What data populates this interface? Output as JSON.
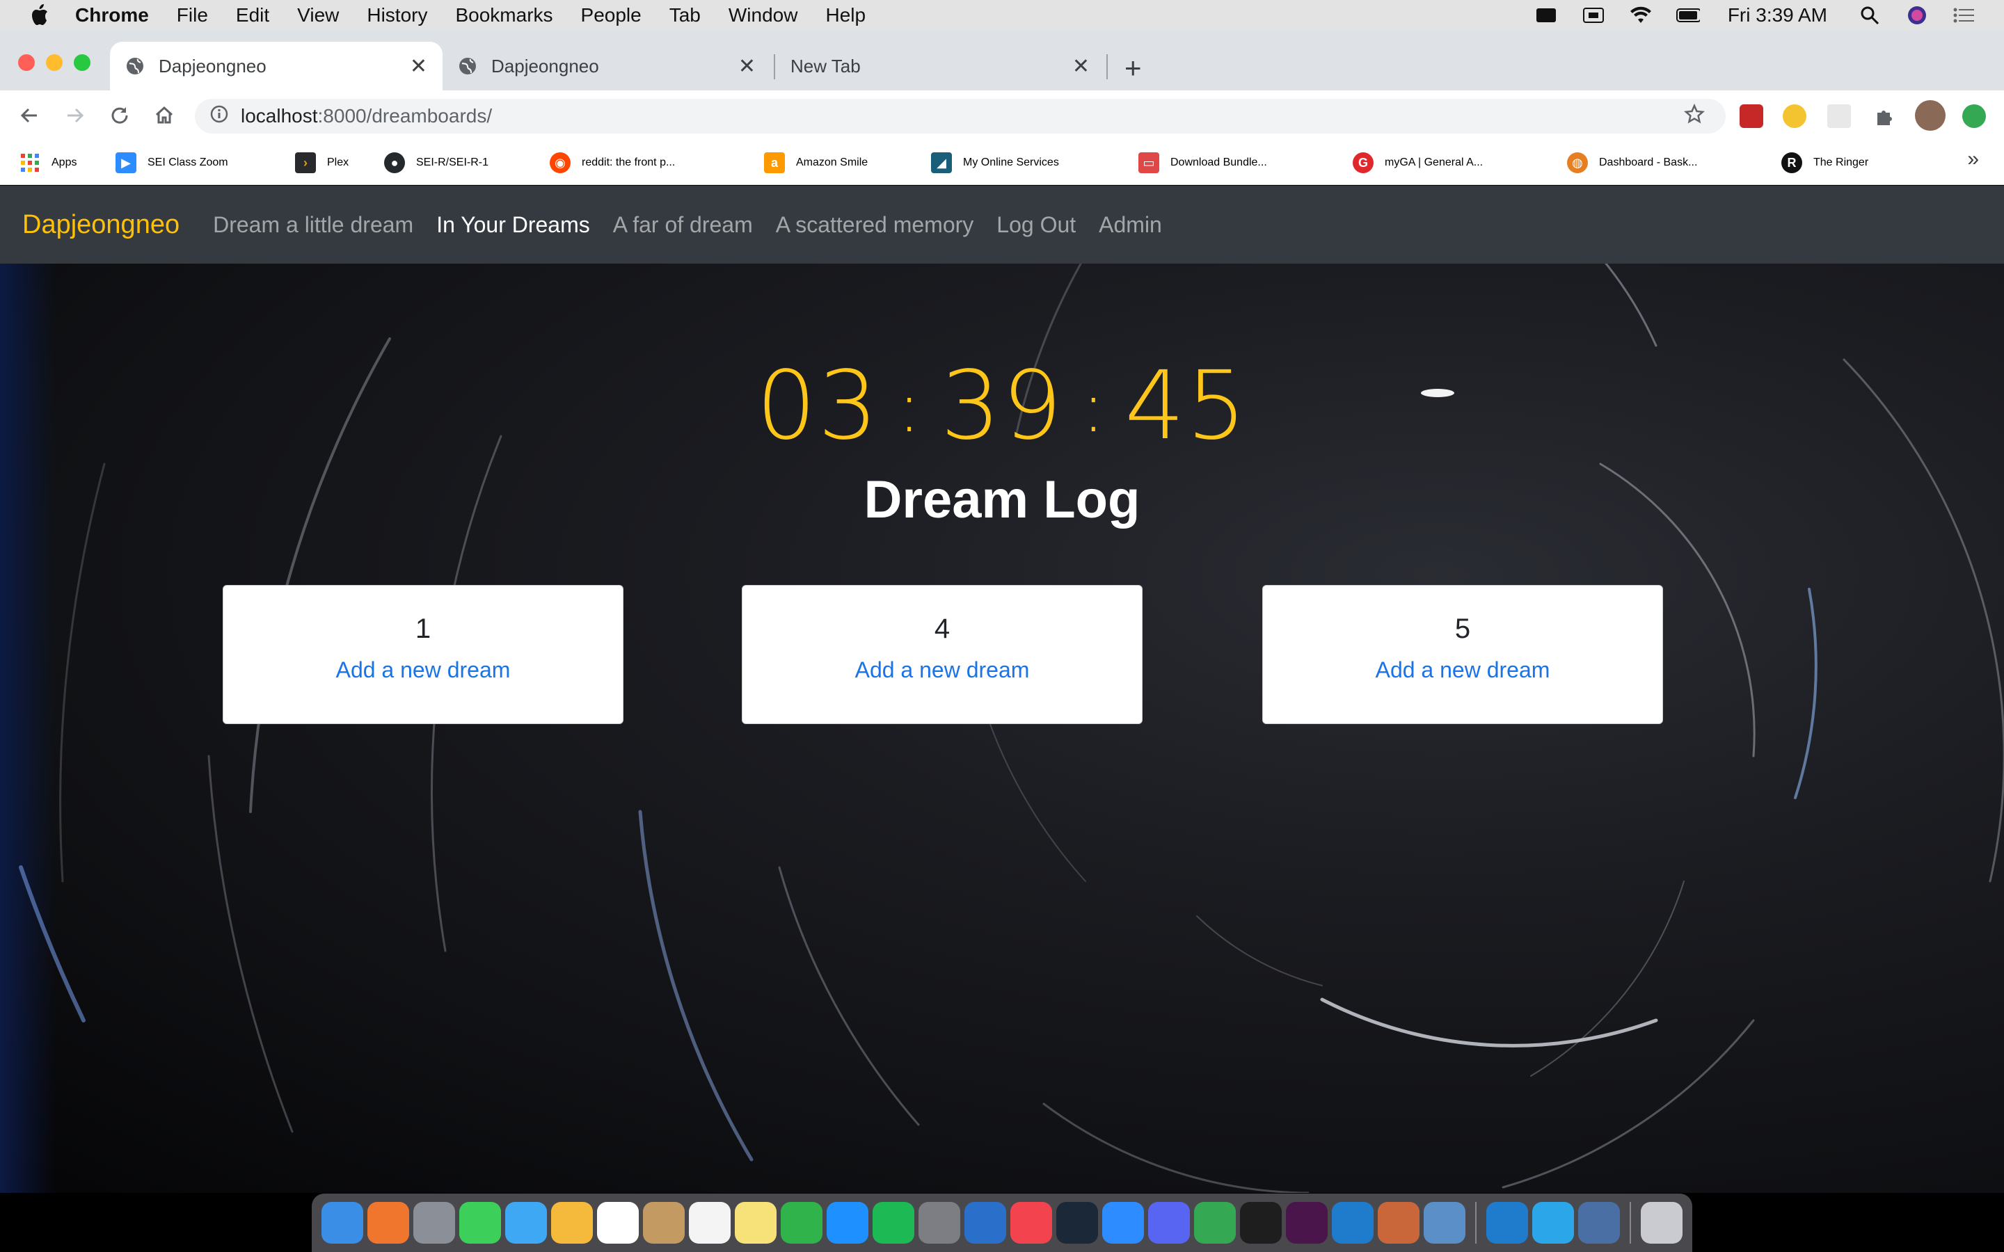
{
  "menubar": {
    "app": "Chrome",
    "items": [
      "File",
      "Edit",
      "View",
      "History",
      "Bookmarks",
      "People",
      "Tab",
      "Window",
      "Help"
    ],
    "clock": "Fri 3:39 AM"
  },
  "tabs": [
    {
      "title": "Dapjeongneo",
      "active": true
    },
    {
      "title": "Dapjeongneo",
      "active": false
    },
    {
      "title": "New Tab",
      "active": false
    }
  ],
  "omnibox": {
    "host": "localhost",
    "path": ":8000/dreamboards/"
  },
  "bookmarks": [
    {
      "label": "Apps",
      "icon": "apps-grid-icon",
      "color": "#ea4335"
    },
    {
      "label": "SEI Class Zoom",
      "icon": "zoom-icon",
      "color": "#2d8cff"
    },
    {
      "label": "Plex",
      "icon": "plex-icon",
      "color": "#282a2d"
    },
    {
      "label": "SEI-R/SEI-R-1",
      "icon": "github-icon",
      "color": "#24292e"
    },
    {
      "label": "reddit: the front p...",
      "icon": "reddit-icon",
      "color": "#ff4500"
    },
    {
      "label": "Amazon Smile",
      "icon": "amazon-icon",
      "color": "#ff9900"
    },
    {
      "label": "My Online Services",
      "icon": "services-icon",
      "color": "#1b5e7a"
    },
    {
      "label": "Download Bundle...",
      "icon": "bundle-icon",
      "color": "#e04848"
    },
    {
      "label": "myGA | General A...",
      "icon": "ga-icon",
      "color": "#e0282c"
    },
    {
      "label": "Dashboard - Bask...",
      "icon": "basketball-icon",
      "color": "#e67e22"
    },
    {
      "label": "The Ringer",
      "icon": "ringer-icon",
      "color": "#111111"
    }
  ],
  "site": {
    "brand": "Dapjeongneo",
    "nav": [
      {
        "label": "Dream a little dream",
        "active": false
      },
      {
        "label": "In Your Dreams",
        "active": true
      },
      {
        "label": "A far of dream",
        "active": false
      },
      {
        "label": "A scattered memory",
        "active": false
      },
      {
        "label": "Log Out",
        "active": false
      },
      {
        "label": "Admin",
        "active": false
      }
    ],
    "clock": {
      "h": "03",
      "m": "39",
      "s": "45",
      "sep": ":"
    },
    "title": "Dream Log",
    "cards": [
      {
        "number": "1",
        "link": "Add a new dream"
      },
      {
        "number": "4",
        "link": "Add a new dream"
      },
      {
        "number": "5",
        "link": "Add a new dream"
      }
    ]
  },
  "colors": {
    "brand": "#ffc107",
    "clock": "#ffc61a",
    "link": "#1a73e8",
    "navbar": "#343a40"
  },
  "dock": [
    {
      "name": "finder-icon",
      "color": "#3a8ee6"
    },
    {
      "name": "safari-icon",
      "color": "#f0762e"
    },
    {
      "name": "launchpad-icon",
      "color": "#8a8f98"
    },
    {
      "name": "facetime-icon",
      "color": "#3ccf5a"
    },
    {
      "name": "messages-icon",
      "color": "#3ea8f5"
    },
    {
      "name": "photos-icon",
      "color": "#f5b93c"
    },
    {
      "name": "calendar-icon",
      "color": "#ffffff"
    },
    {
      "name": "contacts-icon",
      "color": "#c49a63"
    },
    {
      "name": "reminders-icon",
      "color": "#f4f4f4"
    },
    {
      "name": "notes-icon",
      "color": "#f7e27a"
    },
    {
      "name": "numbers-icon",
      "color": "#2fb34a"
    },
    {
      "name": "app-store-icon",
      "color": "#1e90ff"
    },
    {
      "name": "spotify-icon",
      "color": "#1db954"
    },
    {
      "name": "system-preferences-icon",
      "color": "#7d7d84"
    },
    {
      "name": "files-icon",
      "color": "#2a6fc9"
    },
    {
      "name": "news-icon",
      "color": "#f3434f"
    },
    {
      "name": "steam-icon",
      "color": "#1b2838"
    },
    {
      "name": "zoom-app-icon",
      "color": "#2d8cff"
    },
    {
      "name": "discord-icon",
      "color": "#5865f2"
    },
    {
      "name": "chrome-icon",
      "color": "#34a853"
    },
    {
      "name": "terminal-icon",
      "color": "#1e1e1e"
    },
    {
      "name": "slack-icon",
      "color": "#4a154b"
    },
    {
      "name": "vscode-icon",
      "color": "#1f7ccd"
    },
    {
      "name": "game-icon",
      "color": "#c9673a"
    },
    {
      "name": "preview-icon",
      "color": "#5b8fc7"
    },
    {
      "name": "vscode-insiders-icon",
      "color": "#1f7ccd"
    },
    {
      "name": "vscode-2-icon",
      "color": "#2ba6e8"
    },
    {
      "name": "downloads-icon",
      "color": "#4a6fa5"
    },
    {
      "name": "trash-icon",
      "color": "#c9cbd0"
    }
  ]
}
